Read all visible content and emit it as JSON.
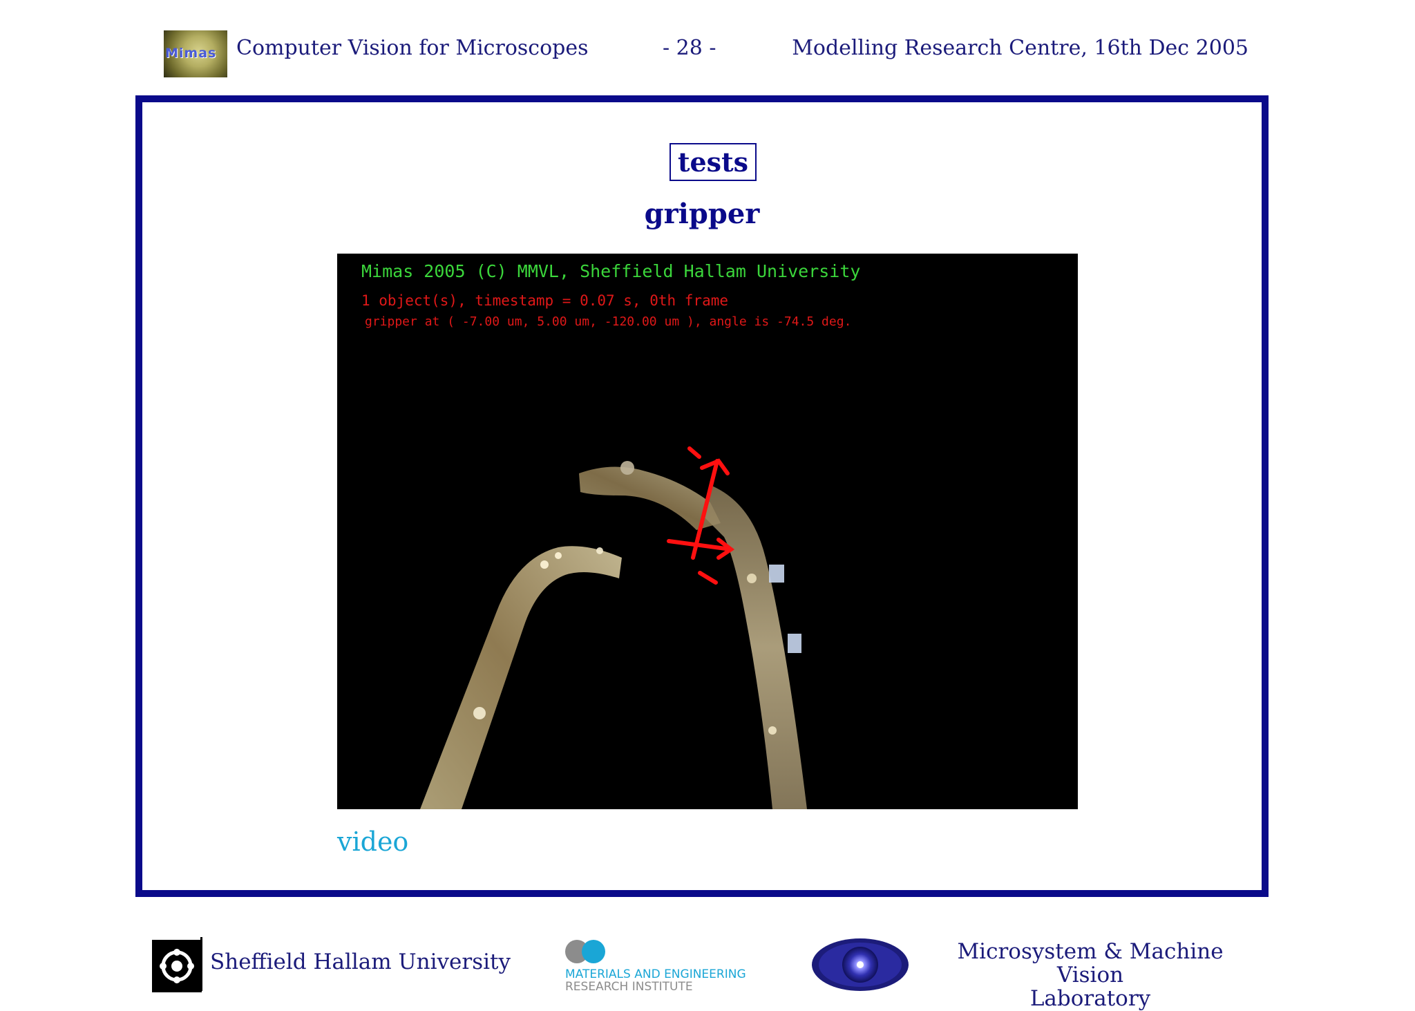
{
  "header": {
    "logo_text": "Mimas",
    "title": "Computer Vision for Microscopes",
    "page": "- 28 -",
    "event": "Modelling Research Centre, 16th Dec 2005"
  },
  "slide": {
    "section_label": "tests",
    "title": "gripper",
    "video_link": "video"
  },
  "video_overlay": {
    "line1": "Mimas 2005 (C) MMVL, Sheffield Hallam University",
    "line2": "1 object(s), timestamp =      0.07 s, 0th frame",
    "line3": "gripper at (    -7.00 um,     5.00 um,  -120.00 um ), angle is  -74.5 deg."
  },
  "colors": {
    "frame": "#0a0a8a",
    "heading": "#0a0a8a",
    "link": "#1aa6d6",
    "overlay_green": "#3bd63b",
    "overlay_red": "#e01818"
  },
  "footer": {
    "university": "Sheffield Hallam University",
    "institute_line1": "MATERIALS AND ENGINEERING",
    "institute_line2": "RESEARCH INSTITUTE",
    "lab_line1": "Microsystem & Machine Vision",
    "lab_line2": "Laboratory"
  }
}
